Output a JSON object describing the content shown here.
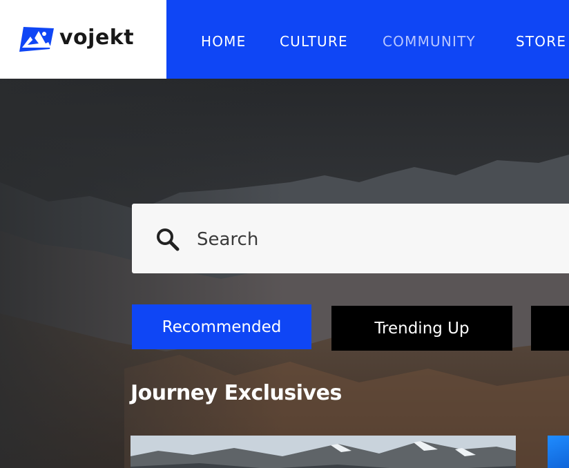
{
  "header": {
    "logo_text": "vojekt",
    "nav": [
      {
        "label": "HOME"
      },
      {
        "label": "CULTURE"
      },
      {
        "label": "COMMUNITY"
      },
      {
        "label": "STORE"
      }
    ],
    "active_nav": "COMMUNITY"
  },
  "search": {
    "placeholder": "Search"
  },
  "filters": [
    {
      "label": "Recommended",
      "active": true
    },
    {
      "label": "Trending Up",
      "active": false
    },
    {
      "label": "",
      "active": false
    }
  ],
  "section": {
    "title": "Journey Exclusives"
  },
  "colors": {
    "brand_blue": "#0f46f5",
    "chip_dark": "#000000",
    "search_bg": "#f7f7f7"
  },
  "icons": [
    "vojekt-logo-icon",
    "search-icon"
  ]
}
